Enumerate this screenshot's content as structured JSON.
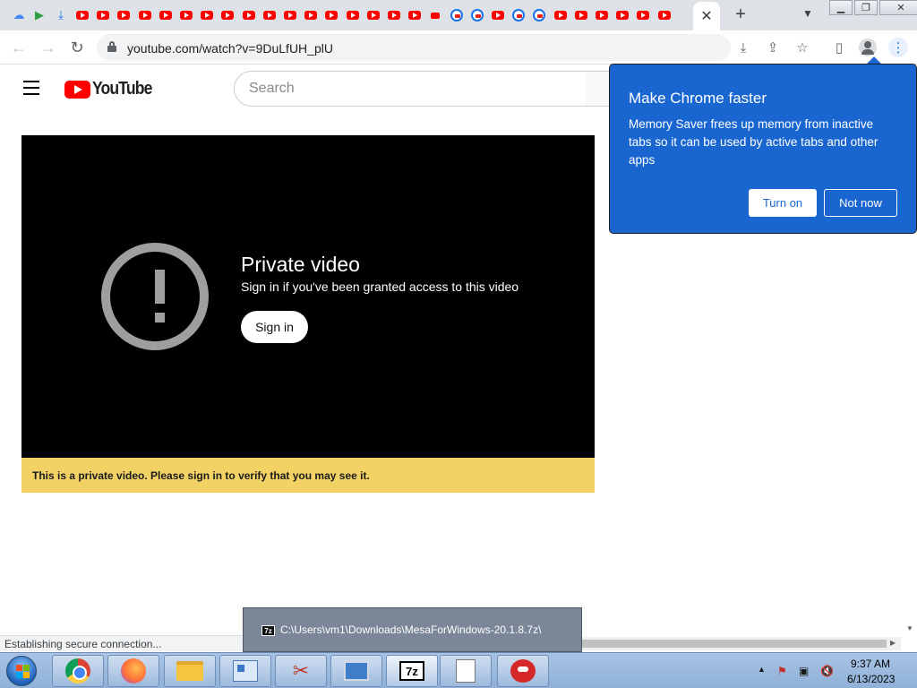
{
  "browser": {
    "active_tab_close": "✕",
    "new_tab": "+",
    "url": "youtube.com/watch?v=9DuLfUH_plU"
  },
  "youtube": {
    "logo_text": "YouTube",
    "search_placeholder": "Search"
  },
  "player": {
    "title": "Private video",
    "subtitle": "Sign in if you've been granted access to this video",
    "signin_label": "Sign in",
    "warning": "This is a private video. Please sign in to verify that you may see it."
  },
  "popup": {
    "title": "Make Chrome faster",
    "body": "Memory Saver frees up memory from inactive tabs so it can be used by active tabs and other apps",
    "turn_on": "Turn on",
    "not_now": "Not now"
  },
  "status": {
    "text": "Establishing secure connection..."
  },
  "tooltip": {
    "badge": "7z",
    "path": "C:\\Users\\vm1\\Downloads\\MesaForWindows-20.1.8.7z\\"
  },
  "taskbar": {
    "items": [
      "chrome",
      "firefox",
      "explorer",
      "control-panel",
      "snipping-tool",
      "remote-desktop",
      "7zip",
      "notepad",
      "angry-birds"
    ],
    "z7_label": "7z",
    "time": "9:37 AM",
    "date": "6/13/2023"
  },
  "colors": {
    "popup_bg": "#1a66d1",
    "warning_bg": "#f2d265",
    "youtube_red": "#ff0000"
  }
}
